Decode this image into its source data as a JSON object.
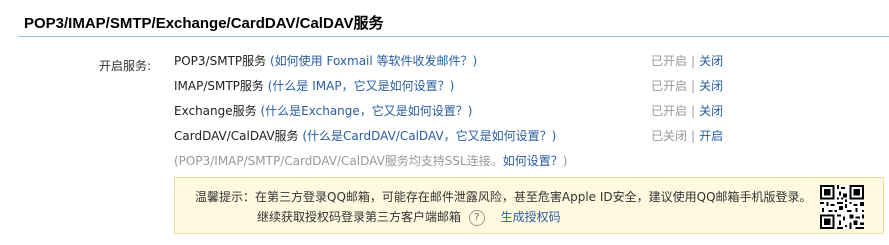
{
  "title": "POP3/IMAP/SMTP/Exchange/CardDAV/CalDAV服务",
  "label": "开启服务:",
  "services": [
    {
      "name": "POP3/SMTP服务",
      "help_prefix": "(如何使用 ",
      "help_link": "Foxmail",
      "help_suffix": " 等软件收发邮件？)",
      "status": "已开启",
      "action": "关闭"
    },
    {
      "name": "IMAP/SMTP服务",
      "help_prefix": "(什么是 IMAP，它又是如何设置？)",
      "help_link": "",
      "help_suffix": "",
      "status": "已开启",
      "action": "关闭"
    },
    {
      "name": "Exchange服务",
      "help_prefix": "(什么是Exchange，它又是如何设置？)",
      "help_link": "",
      "help_suffix": "",
      "status": "已开启",
      "action": "关闭"
    },
    {
      "name": "CardDAV/CalDAV服务",
      "help_prefix": "(什么是CardDAV/CalDAV，它又是如何设置？)",
      "help_link": "",
      "help_suffix": "",
      "status": "已关闭",
      "action": "开启"
    }
  ],
  "ssl_note_prefix": "(POP3/IMAP/SMTP/CardDAV/CalDAV服务均支持SSL连接。",
  "ssl_note_link": "如何设置？",
  "ssl_note_suffix": ")",
  "tip": {
    "line1": "温馨提示：在第三方登录QQ邮箱，可能存在邮件泄露风险，甚至危害Apple ID安全，建议使用QQ邮箱手机版登录。",
    "line2": "继续获取授权码登录第三方客户端邮箱",
    "qmark": "?",
    "generate_link": "生成授权码"
  },
  "colors": {
    "link": "#2a5d9f",
    "muted": "#999999",
    "tip_bg": "#fff9e0",
    "divider": "#9dbce0"
  },
  "icons": [
    "help-circle-icon",
    "qr-code-icon"
  ]
}
